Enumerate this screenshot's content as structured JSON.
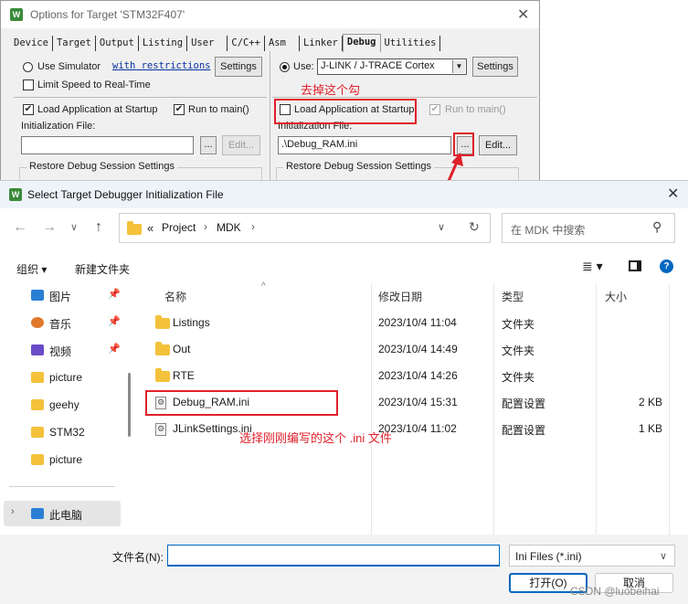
{
  "options_window": {
    "title": "Options for Target 'STM32F407'",
    "tabs": [
      "Device",
      "Target",
      "Output",
      "Listing",
      "User",
      "C/C++",
      "Asm",
      "Linker",
      "Debug",
      "Utilities"
    ],
    "active_tab": "Debug",
    "left": {
      "use_simulator": "Use Simulator",
      "with_restrictions": "with restrictions",
      "settings": "Settings",
      "limit_speed": "Limit Speed to Real-Time",
      "load_app": "Load Application at Startup",
      "run_to_main": "Run to main()",
      "init_file_label": "Initialization File:",
      "browse": "...",
      "edit": "Edit...",
      "restore": "Restore Debug Session Settings"
    },
    "right": {
      "use": "Use:",
      "debugger": "J-LINK / J-TRACE Cortex",
      "settings": "Settings",
      "load_app": "Load Application at Startup",
      "run_to_main": "Run to main()",
      "init_file_label": "Initialization File:",
      "init_file_value": ".\\Debug_RAM.ini",
      "browse": "...",
      "edit": "Edit...",
      "restore": "Restore Debug Session Settings"
    }
  },
  "annotations": {
    "uncheck_note": "去掉这个勾",
    "select_note": "选择刚刚编写的这个 .ini 文件"
  },
  "dialog": {
    "title": "Select Target Debugger Initialization File",
    "breadcrumb": {
      "overflow": "«",
      "items": [
        "Project",
        "MDK"
      ]
    },
    "search_placeholder": "在 MDK 中搜索",
    "toolbar": {
      "organize": "组织 ▾",
      "new_folder": "新建文件夹"
    },
    "sidebar": [
      {
        "label": "图片",
        "icon": "pictures-icon",
        "pinned": true
      },
      {
        "label": "音乐",
        "icon": "music-icon",
        "pinned": true
      },
      {
        "label": "视频",
        "icon": "videos-icon",
        "pinned": true
      },
      {
        "label": "picture",
        "icon": "folder-icon",
        "pinned": false
      },
      {
        "label": "geehy",
        "icon": "folder-icon",
        "pinned": false
      },
      {
        "label": "STM32",
        "icon": "folder-icon",
        "pinned": false
      },
      {
        "label": "picture",
        "icon": "folder-icon",
        "pinned": false
      }
    ],
    "this_pc": "此电脑",
    "columns": [
      "名称",
      "修改日期",
      "类型",
      "大小"
    ],
    "files": [
      {
        "name": "Listings",
        "date": "2023/10/4 11:04",
        "type": "文件夹",
        "size": "",
        "kind": "folder"
      },
      {
        "name": "Out",
        "date": "2023/10/4 14:49",
        "type": "文件夹",
        "size": "",
        "kind": "folder"
      },
      {
        "name": "RTE",
        "date": "2023/10/4 14:26",
        "type": "文件夹",
        "size": "",
        "kind": "folder"
      },
      {
        "name": "Debug_RAM.ini",
        "date": "2023/10/4 15:31",
        "type": "配置设置",
        "size": "2 KB",
        "kind": "ini"
      },
      {
        "name": "JLinkSettings.ini",
        "date": "2023/10/4 11:02",
        "type": "配置设置",
        "size": "1 KB",
        "kind": "ini"
      }
    ],
    "filename_label": "文件名(N):",
    "filename_value": "",
    "filetype": "Ini Files (*.ini)",
    "open": "打开(O)",
    "cancel": "取消"
  },
  "watermark": "CSDN @luobeihai",
  "colors": {
    "annotation": "#e0202a",
    "accent": "#0067c0",
    "folder": "#f4c13a"
  }
}
